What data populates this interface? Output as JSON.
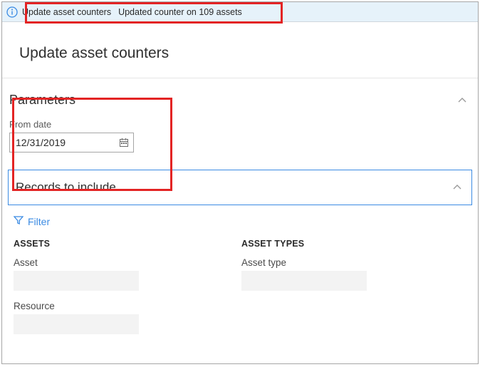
{
  "infobar": {
    "primary": "Update asset counters",
    "secondary": "Updated counter on 109 assets"
  },
  "page_title": "Update asset counters",
  "parameters": {
    "title": "Parameters",
    "from_date_label": "From date",
    "from_date_value": "12/31/2019"
  },
  "records": {
    "title": "Records to include",
    "filter_label": "Filter",
    "columns": {
      "assets": {
        "heading": "ASSETS",
        "asset_label": "Asset",
        "asset_value": "",
        "resource_label": "Resource",
        "resource_value": ""
      },
      "asset_types": {
        "heading": "ASSET TYPES",
        "asset_type_label": "Asset type",
        "asset_type_value": ""
      }
    }
  }
}
